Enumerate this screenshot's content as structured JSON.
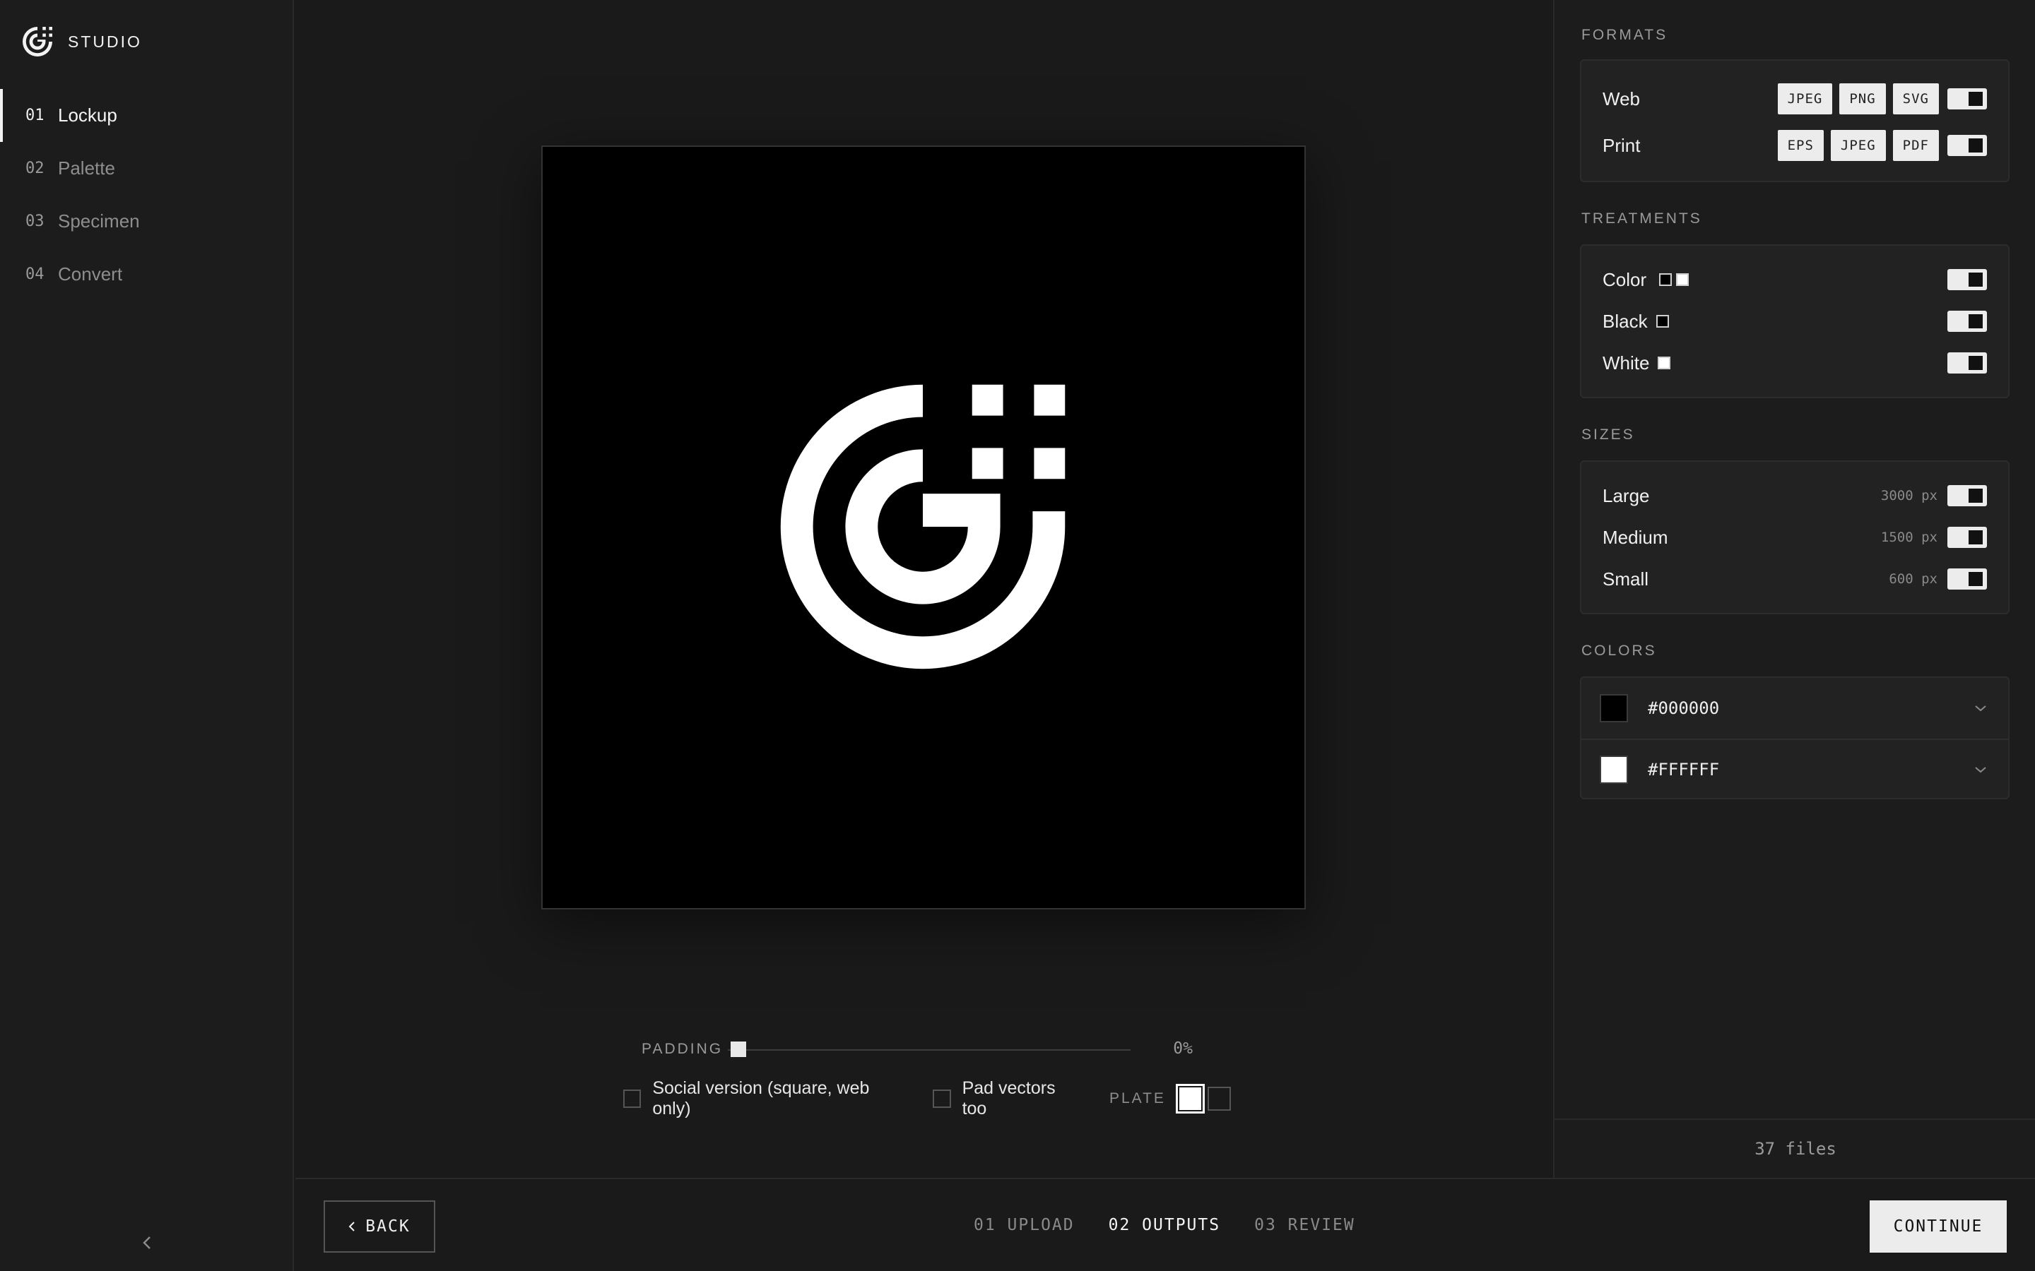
{
  "app": {
    "name": "STUDIO"
  },
  "sidebar": {
    "items": [
      {
        "num": "01",
        "label": "Lockup",
        "active": true
      },
      {
        "num": "02",
        "label": "Palette"
      },
      {
        "num": "03",
        "label": "Specimen"
      },
      {
        "num": "04",
        "label": "Convert"
      }
    ],
    "collapse_icon": "chevron-left-icon"
  },
  "preview": {
    "background": "#000000",
    "padding_label": "PADDING",
    "padding_value": "0%",
    "padding_fraction": 0,
    "social_label": "Social version (square, web only)",
    "pad_vectors_label": "Pad vectors too",
    "plate_label": "PLATE",
    "plate_selected": "white"
  },
  "panel": {
    "formats": {
      "title": "FORMATS",
      "rows": [
        {
          "label": "Web",
          "chips": [
            "JPEG",
            "PNG",
            "SVG"
          ],
          "enabled": true
        },
        {
          "label": "Print",
          "chips": [
            "EPS",
            "JPEG",
            "PDF"
          ],
          "enabled": true
        }
      ]
    },
    "treatments": {
      "title": "TREATMENTS",
      "rows": [
        {
          "label": "Color",
          "swatches": [
            "#000000",
            "#FFFFFF"
          ],
          "enabled": true
        },
        {
          "label": "Black",
          "swatches": [
            "#000000"
          ],
          "enabled": true
        },
        {
          "label": "White",
          "swatches": [
            "#FFFFFF"
          ],
          "enabled": true
        }
      ]
    },
    "sizes": {
      "title": "SIZES",
      "rows": [
        {
          "label": "Large",
          "value": "3000 px",
          "enabled": true
        },
        {
          "label": "Medium",
          "value": "1500 px",
          "enabled": true
        },
        {
          "label": "Small",
          "value": "600 px",
          "enabled": true
        }
      ]
    },
    "colors": {
      "title": "COLORS",
      "rows": [
        {
          "hex": "#000000"
        },
        {
          "hex": "#FFFFFF"
        }
      ]
    },
    "files": "37 files"
  },
  "footer": {
    "back_label": "BACK",
    "steps": [
      {
        "label": "01 UPLOAD"
      },
      {
        "label": "02 OUTPUTS",
        "active": true
      },
      {
        "label": "03 REVIEW"
      }
    ],
    "continue_label": "CONTINUE"
  }
}
